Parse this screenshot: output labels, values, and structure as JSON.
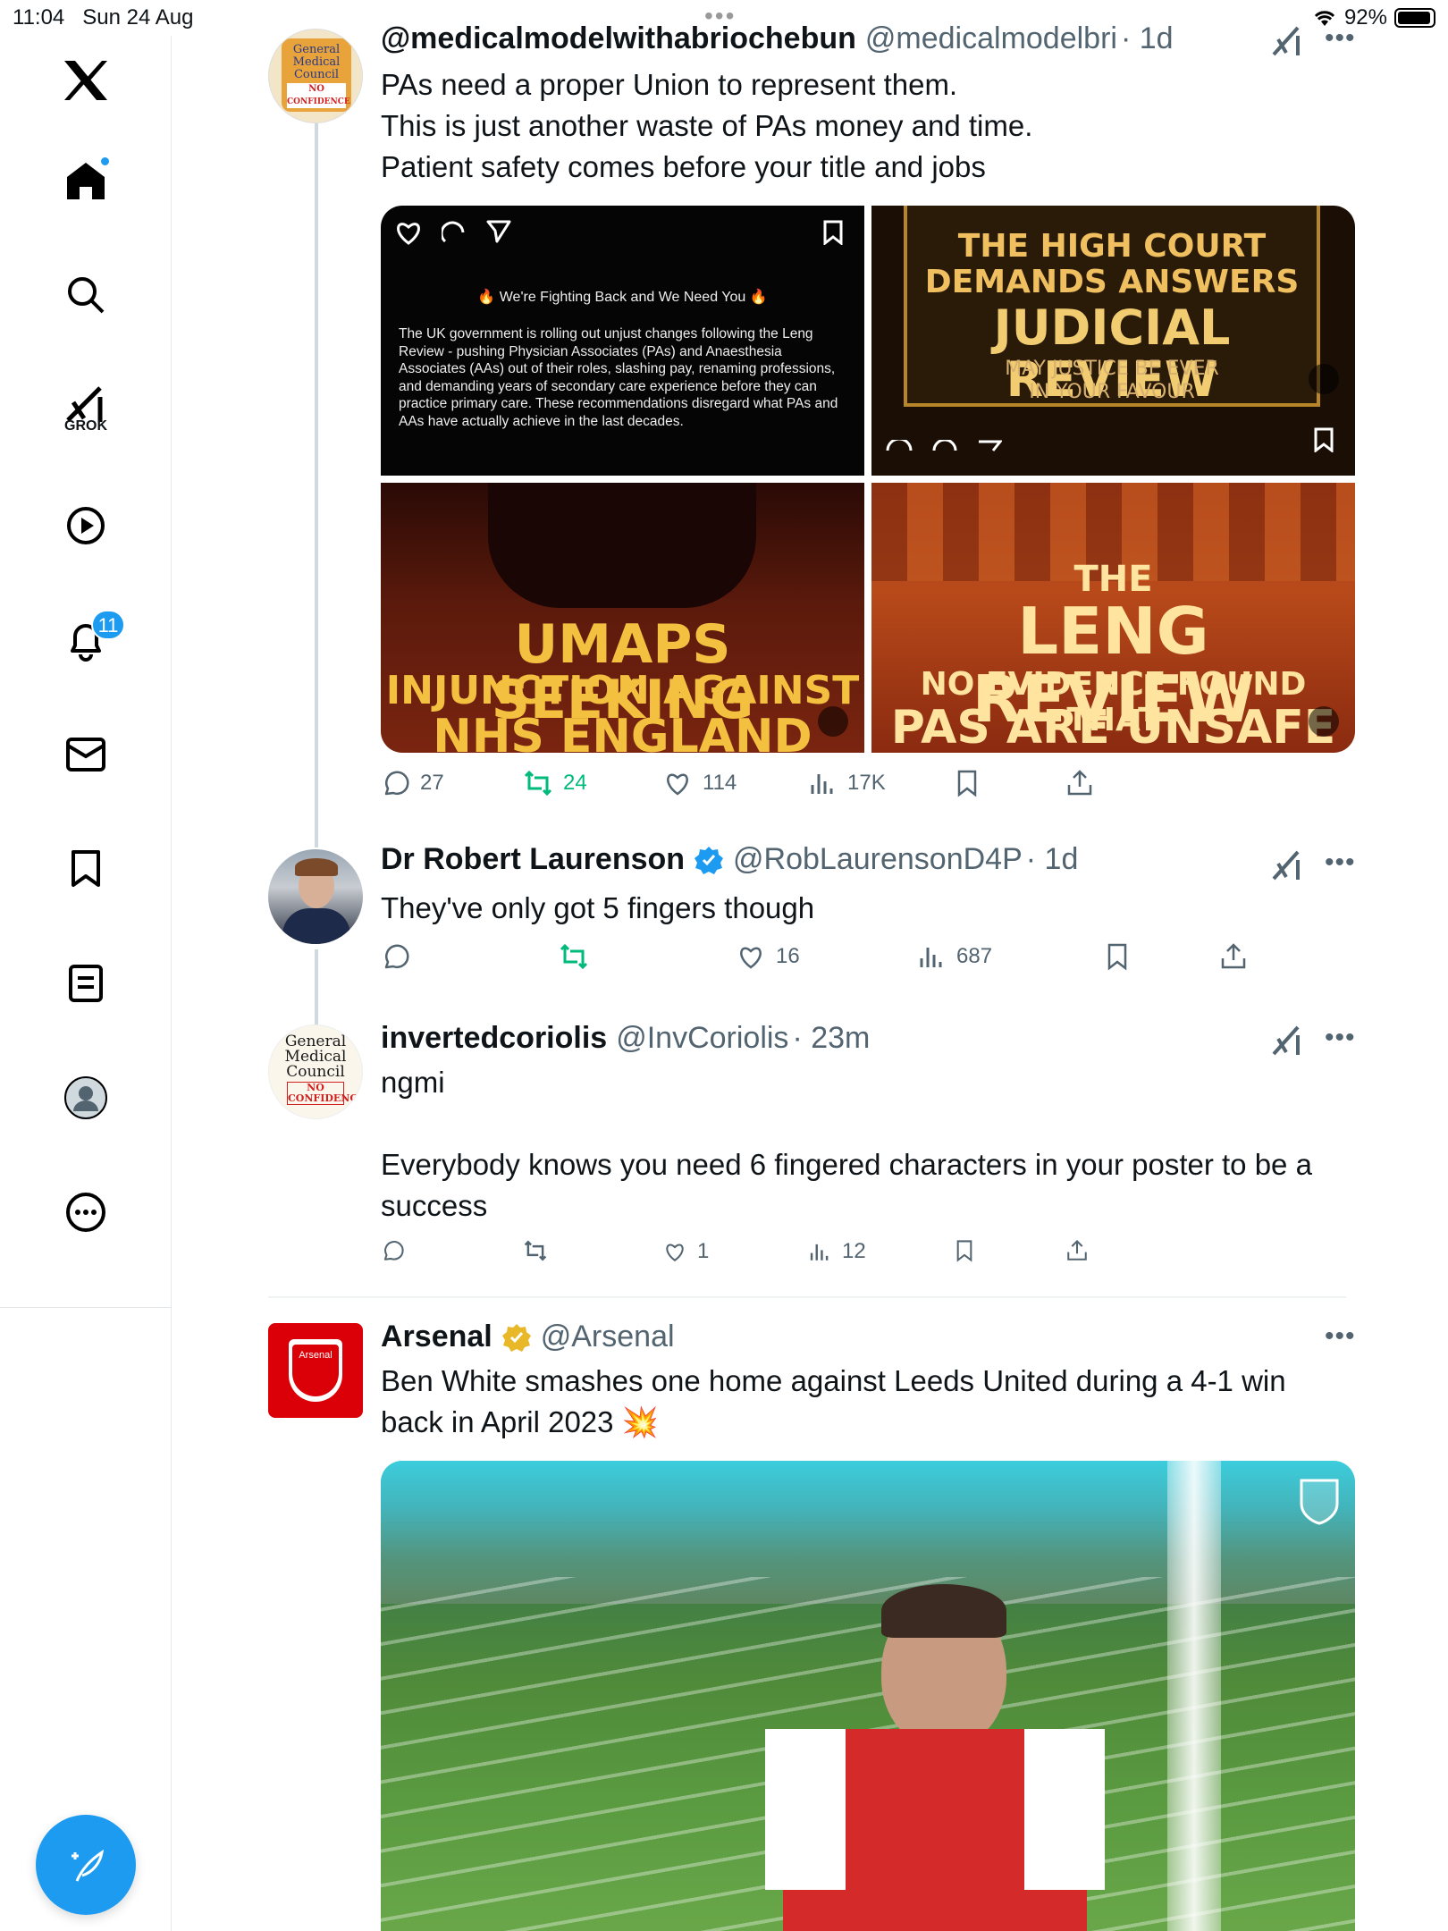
{
  "status_bar": {
    "time": "11:04",
    "date": "Sun 24 Aug",
    "battery": "92%"
  },
  "sidebar": {
    "items": [
      {
        "name": "x-logo-icon"
      },
      {
        "name": "home-icon",
        "has_dot": true
      },
      {
        "name": "search-icon"
      },
      {
        "name": "grok-icon",
        "label": "GROK"
      },
      {
        "name": "video-icon"
      },
      {
        "name": "notifications-icon",
        "count": "11"
      },
      {
        "name": "messages-icon"
      },
      {
        "name": "bookmarks-icon"
      },
      {
        "name": "lists-icon"
      },
      {
        "name": "profile-icon"
      },
      {
        "name": "more-icon"
      }
    ],
    "compose_icon": "compose-icon"
  },
  "tweets": [
    {
      "name": "@medicalmodelwithabriochebun",
      "handle": "@medicalmodelbri",
      "time": "· 1d",
      "text_lines": [
        "PAs need a proper Union to represent them.",
        "This is just another waste of PAs money and time.",
        "Patient safety comes before your  title and jobs"
      ],
      "avatar_text": [
        "General",
        "Medical",
        "Council",
        "NO",
        "CONFIDENCE"
      ],
      "media": {
        "m1_heading": "We're Fighting Back and We Need You",
        "m1_body": "The UK government is rolling out unjust changes following the Leng Review - pushing Physician Associates (PAs) and Anaesthesia Associates (AAs) out of their roles, slashing pay, renaming professions, and demanding years of secondary care experience before they can practice primary care. These recommendations disregard what PAs and AAs have actually achieve in the last decades.",
        "m2_line1": "THE HIGH COURT",
        "m2_line2": "DEMANDS ANSWERS",
        "m2_line3": "JUDICIAL REVIEW",
        "m2_line4": "MAY JUSTICE BE EVER",
        "m2_line5": "IN YOUR FAVOUR",
        "m3_line1": "UMAPs SEEKING",
        "m3_line2": "INJUNCTION AGAINST",
        "m3_line3": "NHS ENGLAND",
        "m4_line1": "THE",
        "m4_line2": "LENG REVIEW",
        "m4_line3": "NO EVIDENCE FOUND THAT",
        "m4_line4": "PAs ARE UNSAFE"
      },
      "replies": "27",
      "reposts": "24",
      "likes": "114",
      "views": "17K"
    },
    {
      "name": "Dr Robert Laurenson",
      "handle": "@RobLaurensonD4P",
      "time": "· 1d",
      "text": "They've only got 5 fingers though",
      "replies": "",
      "reposts": "",
      "likes": "16",
      "views": "687"
    },
    {
      "name": "invertedcoriolis",
      "handle": "@InvCoriolis",
      "time": "· 23m",
      "avatar_text": [
        "General",
        "Medical",
        "Council",
        "NO",
        "CONFIDENCE"
      ],
      "text_line1": "ngmi",
      "text_line2": "Everybody knows you need 6 fingered characters in your poster to be a",
      "text_line3": "success",
      "replies": "",
      "reposts": "",
      "likes": "1",
      "views": "12"
    },
    {
      "name": "Arsenal",
      "handle": "@Arsenal",
      "text_line1": "Ben White smashes one home against Leeds United during a 4-1 win",
      "text_line2": "back in April 2023",
      "emoji": "💥",
      "avatar_text": "Arsenal"
    }
  ],
  "colors": {
    "accent": "#1d9bf0",
    "repost_active": "#00ba7c",
    "muted_text": "#536471",
    "verified_gold": "#e8b829"
  }
}
